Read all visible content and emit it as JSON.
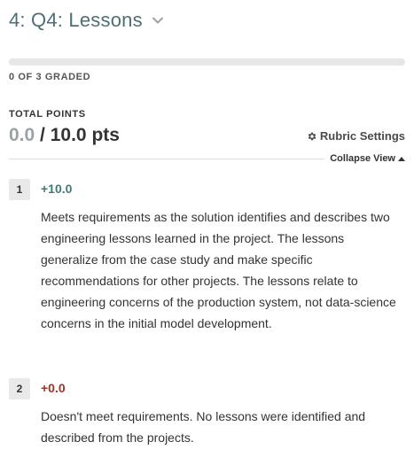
{
  "header": {
    "question_title": "4: Q4: Lessons",
    "chevron_icon": "chevron-down-icon"
  },
  "grading": {
    "progress_fraction": 0,
    "graded_text": "0 OF 3 GRADED"
  },
  "points": {
    "label": "TOTAL POINTS",
    "current": "0.0",
    "separator": "/",
    "total": "10.0 pts"
  },
  "rubric_settings": {
    "label": "Rubric Settings",
    "icon": "gear-icon"
  },
  "collapse_view": {
    "label": "Collapse View",
    "icon": "caret-up-icon"
  },
  "rubric_items": [
    {
      "key": "1",
      "points": "+10.0",
      "description": "Meets requirements as the solution identifies and describes two engineering lessons learned in the project. The lessons generalize from the case study and make specific recommendations for other projects. The lessons relate to engineering concerns of the production system, not data-science concerns in the initial model development."
    },
    {
      "key": "2",
      "points": "+0.0",
      "description": "Doesn't meet requirements. No lessons were identified and described from the projects."
    }
  ],
  "colors": {
    "accent": "#4f6f76",
    "positive": "#3f7c75",
    "zero": "#a13228"
  }
}
